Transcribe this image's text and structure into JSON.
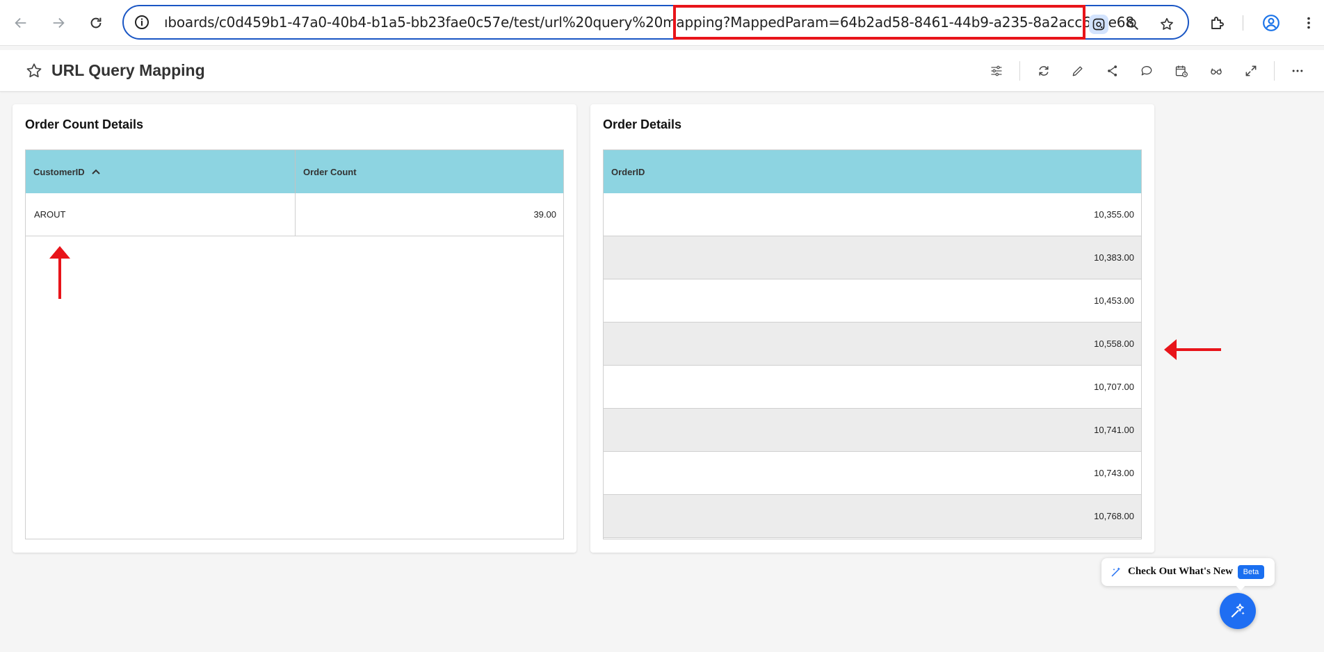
{
  "browser": {
    "url_prefix": "ıboards/c0d459b1-47a0-40b4-b1a5-bb23fae0c57e/test/url%20query%20mapping?MappedParam=64b2ad58-8461-44b9-a235-8a2acc61be68",
    "highlight_color": "#e8141a"
  },
  "dashboard": {
    "title": "URL Query Mapping",
    "header_icons": [
      "filter-icon",
      "refresh-icon",
      "edit-icon",
      "share-icon",
      "comment-icon",
      "schedule-icon",
      "view-icon",
      "fullscreen-icon",
      "more-icon"
    ]
  },
  "widgets": {
    "order_count": {
      "title": "Order Count Details",
      "columns": [
        "CustomerID",
        "Order Count"
      ],
      "rows": [
        {
          "customer_id": "AROUT",
          "order_count": "39.00"
        }
      ]
    },
    "order_details": {
      "title": "Order Details",
      "columns": [
        "OrderID"
      ],
      "rows": [
        "10,355.00",
        "10,383.00",
        "10,453.00",
        "10,558.00",
        "10,707.00",
        "10,741.00",
        "10,743.00",
        "10,768.00"
      ]
    }
  },
  "whats_new": {
    "label": "Check Out What's New",
    "badge": "Beta"
  },
  "colors": {
    "grid_header": "#8dd4e1",
    "accent": "#1f6ef2",
    "annotation": "#e8141a"
  }
}
